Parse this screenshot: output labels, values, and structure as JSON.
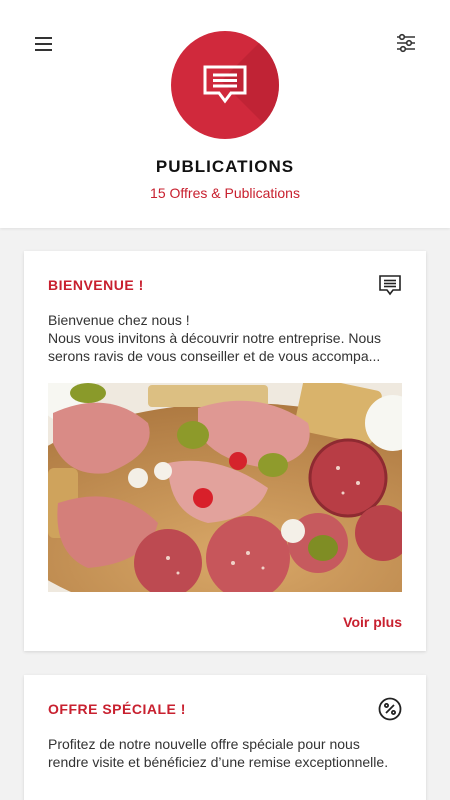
{
  "header": {
    "title": "PUBLICATIONS",
    "subtitle": "15 Offres & Publications",
    "menu_icon": "hamburger-menu-icon",
    "filter_icon": "sliders-filter-icon",
    "avatar_icon": "message-icon",
    "accent_color": "#d0293c"
  },
  "cards": [
    {
      "title": "BIENVENUE !",
      "icon": "message-icon",
      "lines": [
        "Bienvenue chez nous !",
        "Nous vous invitons à découvrir notre entreprise. Nous",
        "serons ravis de vous conseiller et de vous accompa..."
      ],
      "image_icon": "charcuterie-board-photo",
      "action_label": "Voir plus"
    },
    {
      "title": "OFFRE SPÉCIALE !",
      "icon": "percent-badge-icon",
      "lines": [
        "Profitez de notre nouvelle offre spéciale pour nous",
        "rendre visite et bénéficiez d’une remise exceptionnelle."
      ]
    }
  ]
}
